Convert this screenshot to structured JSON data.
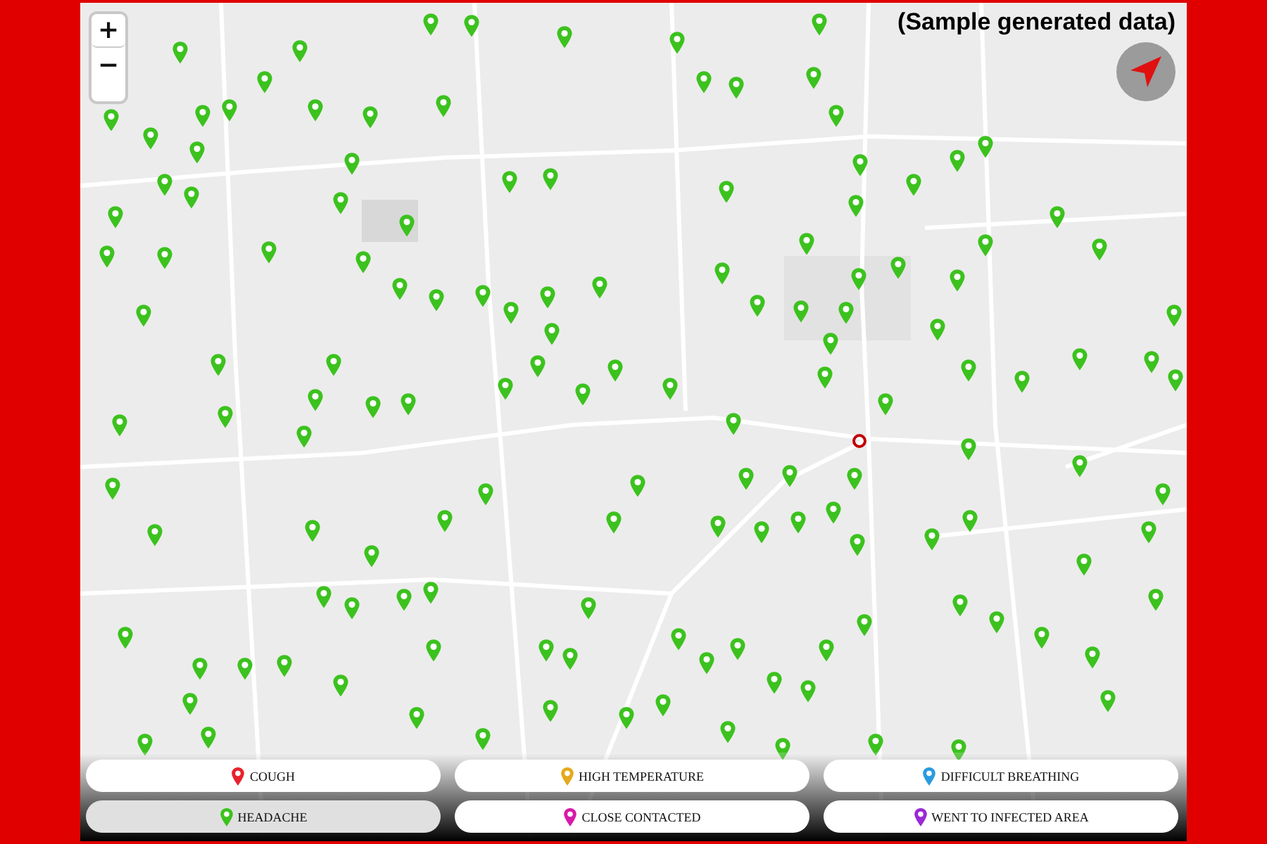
{
  "notice": "(Sample generated data)",
  "zoom_controls": [
    {
      "label": "+"
    },
    {
      "label": "−"
    }
  ],
  "legend": [
    {
      "label": "COUGH",
      "color": "#e8212b",
      "selected": false
    },
    {
      "label": "HIGH TEMPERATURE",
      "color": "#e5a91c",
      "selected": false
    },
    {
      "label": "DIFFICULT BREATHING",
      "color": "#2a9be0",
      "selected": false
    },
    {
      "label": "HEADACHE",
      "color": "#3cc21e",
      "selected": true
    },
    {
      "label": "CLOSE CONTACTED",
      "color": "#d919a8",
      "selected": false
    },
    {
      "label": "WENT TO INFECTED AREA",
      "color": "#9b27d6",
      "selected": false
    }
  ]
}
